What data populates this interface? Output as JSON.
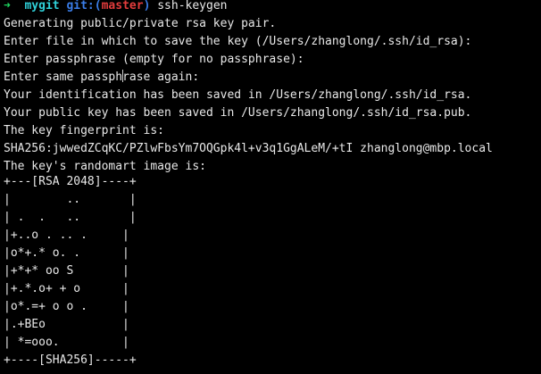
{
  "prompt": {
    "arrow": "➜",
    "dir": "mygit",
    "git_label": "git:(",
    "branch": "master",
    "git_close": ")",
    "command": "ssh-keygen"
  },
  "output": [
    "Generating public/private rsa key pair.",
    "Enter file in which to save the key (/Users/zhanglong/.ssh/id_rsa):",
    "Enter passphrase (empty for no passphrase):",
    "Your identification has been saved in /Users/zhanglong/.ssh/id_rsa.",
    "Your public key has been saved in /Users/zhanglong/.ssh/id_rsa.pub.",
    "The key fingerprint is:",
    "SHA256:jwwedZCqKC/PZlwFbsYm7OQGpk4l+v3q1GgALeM/+tI zhanglong@mbp.local",
    "The key's randomart image is:"
  ],
  "same_passphrase": {
    "before": "Enter same passph",
    "after": "rase again:"
  },
  "randomart": [
    "+---[RSA 2048]----+",
    "|        ..       |",
    "| .  .   ..       |",
    "|+..o . .. .     |",
    "|o*+.* o. .      |",
    "|+*+* oo S       |",
    "|+.*.o+ + o      |",
    "|o*.=+ o o .     |",
    "|.+BEo           |",
    "| *=ooo.         |",
    "+----[SHA256]-----+"
  ],
  "colors": {
    "background": "#000000",
    "text": "#e8e8e8",
    "arrow": "#1ed760",
    "dir": "#2fd0d8",
    "git": "#3a7de8",
    "branch": "#e23c3c"
  },
  "icons": {
    "cursor": "text-cursor-icon"
  }
}
